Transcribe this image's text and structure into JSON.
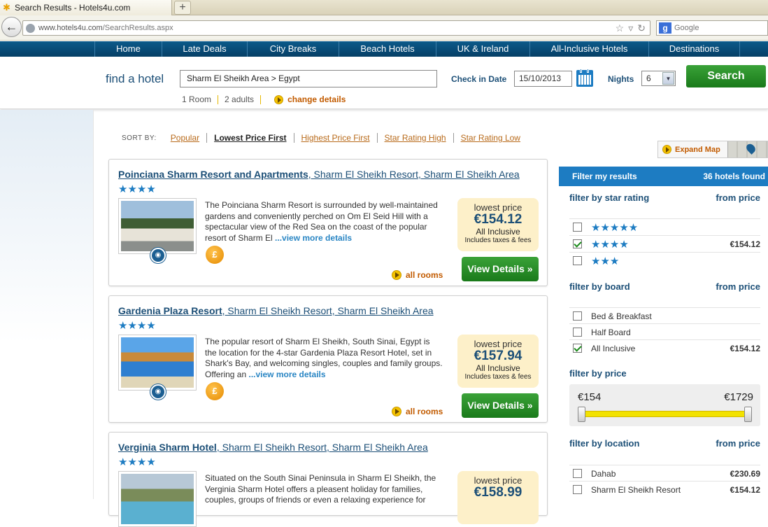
{
  "browser": {
    "tab_title": "Search Results - Hotels4u.com",
    "new_tab": "+",
    "url_domain": "www.hotels4u.com",
    "url_path": "/SearchResults.aspx",
    "search_engine": "Google",
    "google_letter": "g"
  },
  "site_nav": [
    "Home",
    "Late Deals",
    "City Breaks",
    "Beach Hotels",
    "UK & Ireland",
    "All-Inclusive Hotels",
    "Destinations"
  ],
  "find": {
    "label": "find a hotel",
    "destination": "Sharm El Sheikh Area > Egypt",
    "check_in_label": "Check in Date",
    "check_in": "15/10/2013",
    "nights_label": "Nights",
    "nights": "6",
    "search_label": "Search",
    "rooms": "1 Room",
    "adults": "2 adults",
    "change": "change details"
  },
  "sort": {
    "label": "SORT BY:",
    "options": [
      "Popular",
      "Lowest Price First",
      "Highest Price First",
      "Star Rating High",
      "Star Rating Low"
    ],
    "active": "Lowest Price First"
  },
  "results": [
    {
      "name": "Poinciana Sharm Resort and Apartments",
      "location": ", Sharm El Sheikh Resort, Sharm El Sheikh Area",
      "stars": "★★★★",
      "desc": "The Poinciana Sharm Resort is surrounded by well-maintained gardens and conveniently perched on Om El Seid Hill with a spectacular view of the Red Sea on the coast of the popular resort of Sharm El ",
      "more": "...view more details",
      "price_label": "lowest price",
      "price": "€154.12",
      "board": "All Inclusive",
      "taxes": "Includes taxes & fees",
      "all_rooms": "all rooms",
      "view": "View Details »",
      "currency_icon": "£"
    },
    {
      "name": "Gardenia Plaza Resort",
      "location": ", Sharm El Sheikh Resort, Sharm El Sheikh Area",
      "stars": "★★★★",
      "desc": "The popular resort of Sharm El Sheikh, South Sinai, Egypt is the location for the 4-star Gardenia Plaza Resort Hotel, set in Shark's Bay, and welcoming singles, couples and family groups. Offering an ",
      "more": "...view more details",
      "price_label": "lowest price",
      "price": "€157.94",
      "board": "All Inclusive",
      "taxes": "Includes taxes & fees",
      "all_rooms": "all rooms",
      "view": "View Details »",
      "currency_icon": "£"
    },
    {
      "name": "Verginia Sharm Hotel",
      "location": ", Sharm El Sheikh Resort, Sharm El Sheikh Area",
      "stars": "★★★★",
      "desc": "Situated on the South Sinai Peninsula in Sharm El Sheikh, the Verginia Sharm Hotel offers a pleasent holiday for families, couples, groups of friends or even a relaxing experience for",
      "more": "",
      "price_label": "lowest price",
      "price": "€158.99",
      "board": "",
      "taxes": "",
      "all_rooms": "",
      "view": "",
      "currency_icon": ""
    }
  ],
  "map": {
    "expand": "Expand Map"
  },
  "filters": {
    "title": "Filter my results",
    "count": "36 hotels found",
    "star_title": "filter by star rating",
    "from_price": "from price",
    "stars": [
      {
        "label": "★★★★★",
        "checked": false,
        "price": ""
      },
      {
        "label": "★★★★",
        "checked": true,
        "price": "€154.12"
      },
      {
        "label": "★★★",
        "checked": false,
        "price": ""
      }
    ],
    "board_title": "filter by board",
    "boards": [
      {
        "label": "Bed & Breakfast",
        "checked": false,
        "price": ""
      },
      {
        "label": "Half Board",
        "checked": false,
        "price": ""
      },
      {
        "label": "All Inclusive",
        "checked": true,
        "price": "€154.12"
      }
    ],
    "price_title": "filter by price",
    "price_min": "€154",
    "price_max": "€1729",
    "location_title": "filter by location",
    "locations": [
      {
        "label": "Dahab",
        "checked": false,
        "price": "€230.69"
      },
      {
        "label": "Sharm El Sheikh Resort",
        "checked": false,
        "price": "€154.12"
      }
    ]
  }
}
